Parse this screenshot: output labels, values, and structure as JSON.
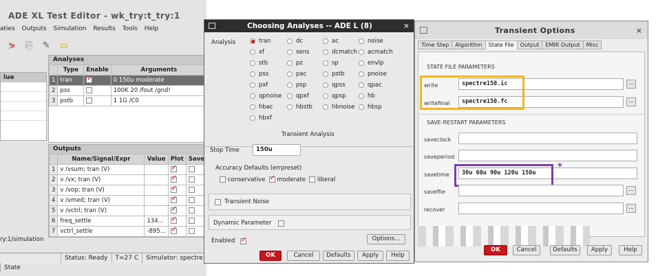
{
  "ade": {
    "title": "ADE XL Test Editor - wk_try:t_try:1",
    "menu": [
      "aties",
      "Outputs",
      "Simulation",
      "Results",
      "Tools",
      "Help"
    ],
    "left_col_header": "lue",
    "analyses": {
      "title": "Analyses",
      "columns": [
        "Type",
        "Enable",
        "Arguments"
      ],
      "rows": [
        {
          "n": "1",
          "type": "tran",
          "enable": true,
          "args": "0 150u moderate"
        },
        {
          "n": "2",
          "type": "pss",
          "enable": false,
          "args": "100K 20 /fout /gnd!"
        },
        {
          "n": "3",
          "type": "pstb",
          "enable": false,
          "args": "1 1G /C0"
        }
      ]
    },
    "outputs": {
      "title": "Outputs",
      "columns": [
        "Name/Signal/Expr",
        "Value",
        "Plot",
        "Save"
      ],
      "rows": [
        {
          "n": "1",
          "name": "v /vsum; tran (V)",
          "value": "",
          "plot": true,
          "save": false
        },
        {
          "n": "2",
          "name": "v /vx; tran (V)",
          "value": "",
          "plot": true,
          "save": false
        },
        {
          "n": "3",
          "name": "v /vop; tran (V)",
          "value": "",
          "plot": true,
          "save": false
        },
        {
          "n": "4",
          "name": "v /vmed; tran (V)",
          "value": "",
          "plot": true,
          "save": false
        },
        {
          "n": "5",
          "name": "v /vctrl; tran (V)",
          "value": "",
          "plot": true,
          "save": false
        },
        {
          "n": "6",
          "name": "freq_settle",
          "value": "134...",
          "plot": true,
          "save": false
        },
        {
          "n": "7",
          "name": "vctrl_settle",
          "value": "-895...",
          "plot": true,
          "save": false
        }
      ]
    },
    "path_text": "ry:1/simulation",
    "status": [
      "Status: Ready",
      "T=27 C",
      "Simulator: spectre",
      "State"
    ]
  },
  "choosing": {
    "title": "Choosing Analyses -- ADE L (8)",
    "analysis_label": "Analysis",
    "options": [
      "tran",
      "dc",
      "ac",
      "noise",
      "xf",
      "sens",
      "dcmatch",
      "acmatch",
      "stb",
      "pz",
      "sp",
      "envlp",
      "pss",
      "pac",
      "pstb",
      "pnoise",
      "pxf",
      "psp",
      "qpss",
      "qpac",
      "qpnoise",
      "qpxf",
      "qpsp",
      "hb",
      "hbac",
      "hbstb",
      "hbnoise",
      "hbsp",
      "hbxf"
    ],
    "selected": "tran",
    "section_title": "Transient Analysis",
    "stop_time_label": "Stop Time",
    "stop_time_value": "150u",
    "accuracy_label": "Accuracy Defaults (errpreset)",
    "accuracy": [
      {
        "label": "conservative",
        "checked": false
      },
      {
        "label": "moderate",
        "checked": true
      },
      {
        "label": "liberal",
        "checked": false
      }
    ],
    "transient_noise_label": "Transient Noise",
    "dynamic_param_label": "Dynamic Parameter",
    "enabled_label": "Enabled",
    "options_button": "Options...",
    "buttons": {
      "ok": "OK",
      "cancel": "Cancel",
      "defaults": "Defaults",
      "apply": "Apply",
      "help": "Help"
    }
  },
  "transient": {
    "title": "Transient Options",
    "tabs": [
      "Time Step",
      "Algorithm",
      "State File",
      "Output",
      "EMIR Output",
      "Misc"
    ],
    "active_tab": "State File",
    "state_header": "STATE FILE PARAMETERS",
    "write_label": "write",
    "write_value": "spectre150.ic",
    "writefinal_label": "writefinal",
    "writefinal_value": "spectre150.fc",
    "save_header": "SAVE-RESTART PARAMETERS",
    "saveclock_label": "saveclock",
    "saveperiod_label": "saveperiod",
    "savetime_label": "savetime",
    "savetime_value": "30u 60u 90u 120u 150u",
    "savefile_label": "savefile",
    "recover_label": "recover",
    "dots": "...",
    "asterisk": "*",
    "buttons": {
      "ok": "OK",
      "cancel": "Cancel",
      "defaults": "Defaults",
      "apply": "Apply",
      "help": "Help"
    },
    "highlight_colors": {
      "yellow": "#f3b51b",
      "purple": "#7a3fa8"
    }
  },
  "colors": {
    "ok_red": "#c9151d",
    "check_red": "#d01010",
    "selected_row": "#6e6e6e"
  }
}
